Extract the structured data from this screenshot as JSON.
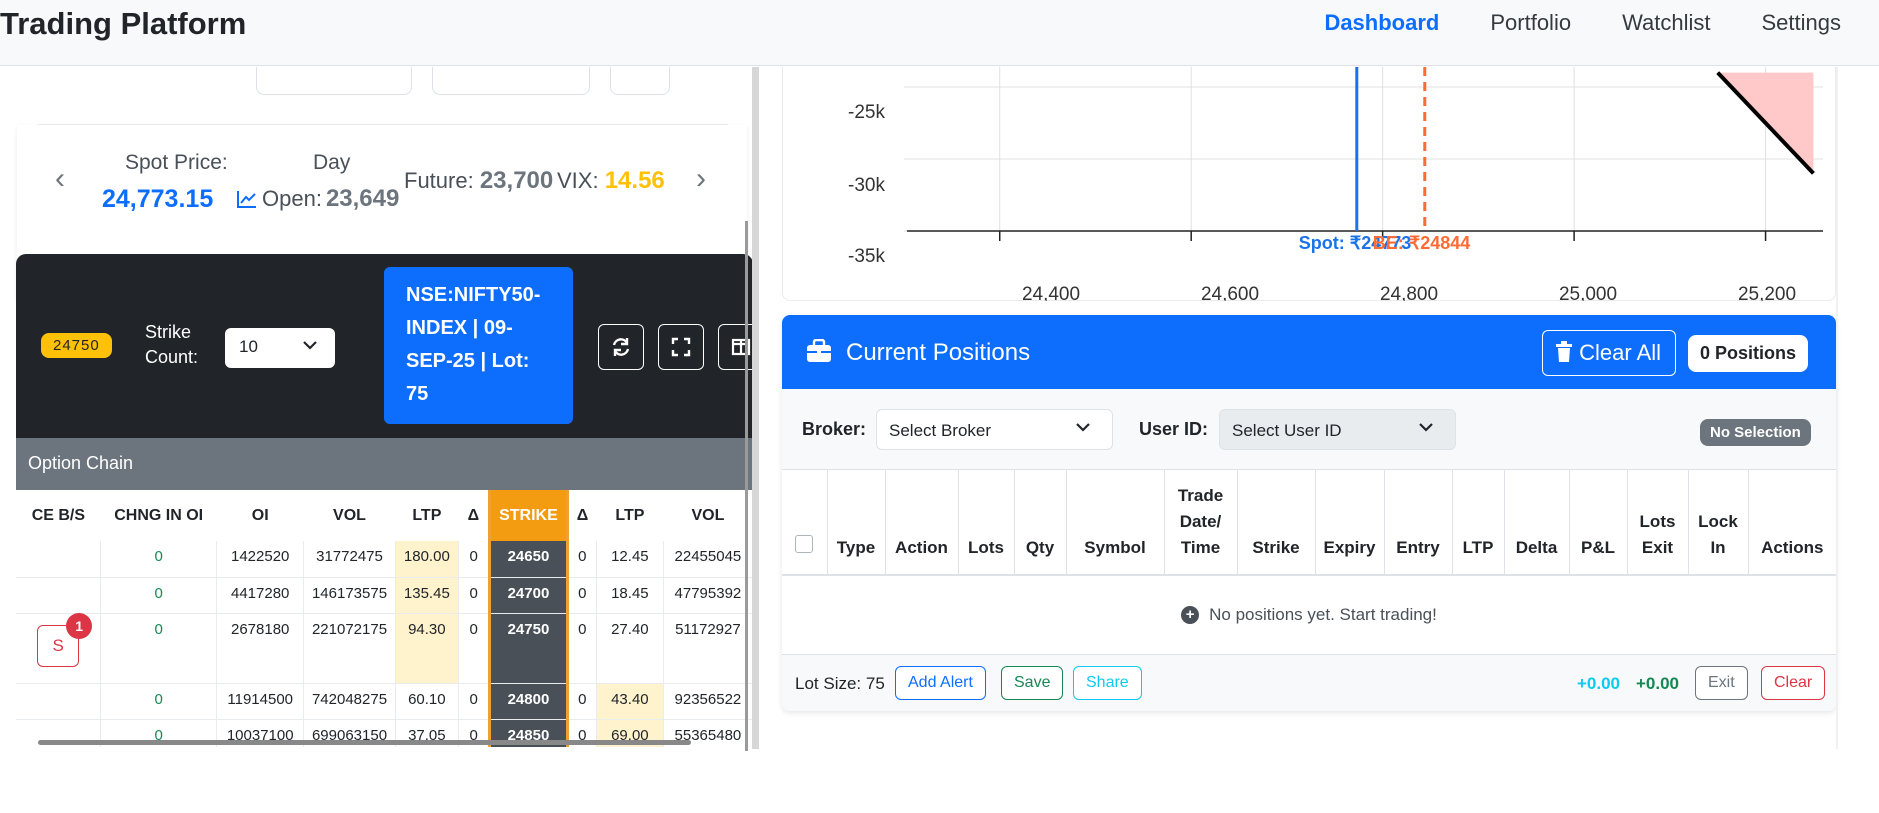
{
  "nav": {
    "brand": "Trading Platform",
    "links": [
      "Dashboard",
      "Portfolio",
      "Watchlist",
      "Settings"
    ],
    "active": "Dashboard"
  },
  "spot": {
    "spot_label": "Spot Price:",
    "spot_value": "24,773.15",
    "day_label": "Day",
    "open_label": "Open:",
    "open_value": "23,649",
    "future_label": "Future:",
    "future_value": "23,700",
    "vix_label": "VIX:",
    "vix_value": "14.56"
  },
  "controls": {
    "atm_strike": "24750",
    "strike_count_label": "Strike Count:",
    "strike_count_value": "10",
    "symbol_info": "NSE:NIFTY50-INDEX | 09-SEP-25 | Lot: 75",
    "icons": [
      "refresh-icon",
      "fullscreen-icon",
      "columns-icon"
    ]
  },
  "option_chain": {
    "title": "Option Chain",
    "columns": [
      "CE B/S",
      "CHNG IN OI",
      "OI",
      "VOL",
      "LTP",
      "Δ",
      "STRIKE",
      "Δ",
      "LTP",
      "VOL"
    ],
    "rows": [
      {
        "bs": "",
        "chng": "0",
        "oi": "1422520",
        "vol": "31772475",
        "ltp": "180.00",
        "d1": "0",
        "strike": "24650",
        "d2": "0",
        "pltp": "12.45",
        "pvol": "22455045"
      },
      {
        "bs": "",
        "chng": "0",
        "oi": "4417280",
        "vol": "146173575",
        "ltp": "135.45",
        "d1": "0",
        "strike": "24700",
        "d2": "0",
        "pltp": "18.45",
        "pvol": "47795392"
      },
      {
        "bs": "S",
        "badge": "1",
        "chng": "0",
        "oi": "2678180",
        "vol": "221072175",
        "ltp": "94.30",
        "d1": "0",
        "strike": "24750",
        "d2": "0",
        "pltp": "27.40",
        "pvol": "51172927"
      },
      {
        "bs": "",
        "chng": "0",
        "oi": "11914500",
        "vol": "742048275",
        "ltp": "60.10",
        "d1": "0",
        "strike": "24800",
        "d2": "0",
        "pltp": "43.40",
        "pvol": "92356522"
      },
      {
        "bs": "",
        "chng": "0",
        "oi": "10037100",
        "vol": "699063150",
        "ltp": "37.05",
        "d1": "0",
        "strike": "24850",
        "d2": "0",
        "pltp": "69.00",
        "pvol": "55365480"
      }
    ]
  },
  "payoff_chart": {
    "y_ticks": [
      "-25k",
      "-30k",
      "-35k"
    ],
    "x_ticks": [
      "24,400",
      "24,600",
      "24,800",
      "25,000",
      "25,200"
    ],
    "spot_label": "Spot: ₹24773",
    "be_label": "BE: ₹24844",
    "spot_color": "#1a73e8",
    "be_color": "#ff6b35",
    "loss_fill": "#ffc9c9"
  },
  "chart_data": {
    "type": "line",
    "title": "",
    "xlabel": "",
    "ylabel": "",
    "x": [
      24750,
      25000,
      25150,
      25250
    ],
    "xlim": [
      24300,
      25260
    ],
    "ylim": [
      -36000,
      -22000
    ],
    "series": [
      {
        "values": [
          null,
          null,
          -24000,
          -31000
        ]
      }
    ],
    "annotations": [
      {
        "label": "Spot: ₹24773",
        "x": 24773
      },
      {
        "label": "BE: ₹24844",
        "x": 24844
      }
    ]
  },
  "positions": {
    "title": "Current Positions",
    "clear_all": "Clear All",
    "count": "0 Positions",
    "broker_label": "Broker:",
    "broker_placeholder": "Select Broker",
    "user_label": "User ID:",
    "user_placeholder": "Select User ID",
    "selection_badge": "No Selection",
    "columns": [
      "Type",
      "Action",
      "Lots",
      "Qty",
      "Symbol",
      "Trade Date/ Time",
      "Strike",
      "Expiry",
      "Entry",
      "LTP",
      "Delta",
      "P&L",
      "Lots Exit",
      "Lock In",
      "Actions"
    ],
    "empty_message": "No positions yet. Start trading!",
    "lot_size": "Lot Size: 75",
    "buttons": {
      "alert": "Add Alert",
      "save": "Save",
      "share": "Share",
      "exit": "Exit",
      "clear": "Clear"
    },
    "pnl_a": "+0.00",
    "pnl_b": "+0.00"
  }
}
